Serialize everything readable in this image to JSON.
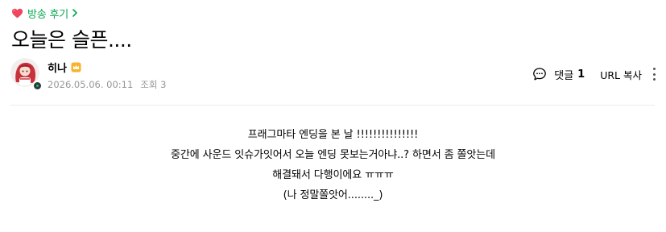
{
  "board": {
    "name": "방송 후기",
    "icon": "heart-icon"
  },
  "post": {
    "title": "오늘은 슬픈....",
    "author": {
      "nickname": "히나",
      "badge_icon": "crown-icon"
    },
    "date": "2026.05.06. 00:11",
    "views_label": "조회 3",
    "content_lines": [
      "프래그마타 엔딩을 본 날 !!!!!!!!!!!!!!!",
      "중간에 사운드 잇슈가잇어서 오늘 엔딩 못보는거아냐..? 하면서 좀 쫄앗는데",
      "해결돼서 다행이에요 ㅠㅠㅠ",
      "(나 정말쫄앗어........_)"
    ]
  },
  "actions": {
    "comment_label": "댓글",
    "comment_count": "1",
    "copy_url_label": "URL 복사"
  },
  "colors": {
    "board_accent": "#03a94f",
    "meta_gray": "#979797",
    "divider": "#ebebeb"
  }
}
